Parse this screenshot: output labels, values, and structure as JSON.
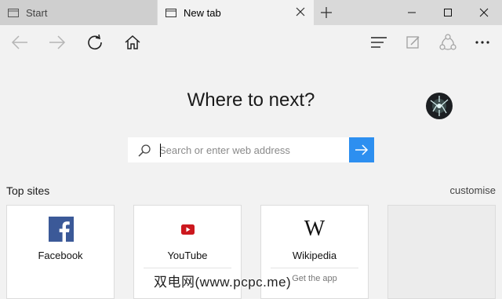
{
  "tabs": [
    {
      "label": "Start",
      "active": false
    },
    {
      "label": "New tab",
      "active": true
    }
  ],
  "window_controls": [
    "minimize-icon",
    "maximize-icon",
    "close-icon"
  ],
  "toolbar": {
    "left": [
      "back-arrow-icon",
      "forward-arrow-icon",
      "refresh-icon",
      "home-icon"
    ],
    "right": [
      "hub-icon",
      "web-note-icon",
      "share-icon",
      "more-icon"
    ]
  },
  "main": {
    "headline": "Where to next?",
    "search": {
      "placeholder": "Search or enter web address",
      "value": ""
    }
  },
  "top_sites": {
    "title": "Top sites",
    "customise_label": "customise",
    "tiles": [
      {
        "label": "Facebook",
        "icon": "facebook-icon",
        "brand_color": "#3b5998"
      },
      {
        "label": "YouTube",
        "icon": "youtube-icon",
        "brand_color": "#cc181e"
      },
      {
        "label": "Wikipedia",
        "icon": "wikipedia-icon",
        "sub": "Get the app"
      },
      {
        "label": ""
      }
    ]
  },
  "colors": {
    "accent": "#2d8ff0",
    "tabstrip": "#d9d9d9",
    "page": "#f2f2f2"
  },
  "watermark": "双电网(www.pcpc.me)"
}
